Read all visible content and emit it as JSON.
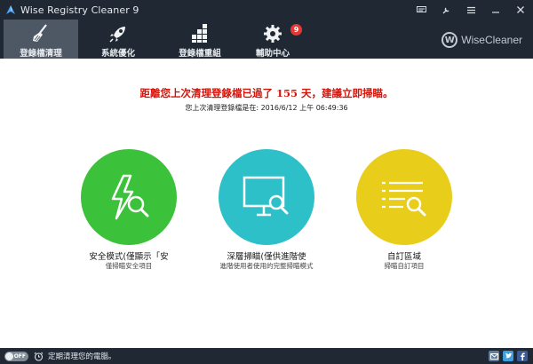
{
  "window": {
    "title": "Wise Registry Cleaner 9"
  },
  "nav": {
    "tabs": [
      {
        "label": "登錄檔清理",
        "icon": "broom-icon",
        "active": true
      },
      {
        "label": "系統優化",
        "icon": "rocket-icon",
        "active": false
      },
      {
        "label": "登錄檔重組",
        "icon": "defrag-icon",
        "active": false
      },
      {
        "label": "輔助中心",
        "icon": "gear-icon",
        "active": false
      }
    ],
    "badge_count": "9",
    "brand": {
      "logo_letter": "W",
      "name": "WiseCleaner"
    }
  },
  "notice": {
    "warning": "距離您上次清理登錄檔已過了 155 天，建議立即掃瞄。",
    "last_clean": "您上次清理登錄檔是在: 2016/6/12 上午 06:49:36"
  },
  "modes": [
    {
      "title": "安全模式(僅顯示「安",
      "desc": "僅掃瞄安全項目",
      "color": "#3cc13b",
      "icon": "lightning-magnifier-icon"
    },
    {
      "title": "深層掃瞄(僅供進階使",
      "desc": "進階使用者使用的完整掃瞄模式",
      "color": "#2ec0c8",
      "icon": "monitor-magnifier-icon"
    },
    {
      "title": "自訂區域",
      "desc": "掃瞄自訂項目",
      "color": "#e8cd1a",
      "icon": "list-magnifier-icon"
    }
  ],
  "status": {
    "toggle_state": "OFF",
    "schedule_text": "定期清理您的電腦。"
  },
  "colors": {
    "chrome": "#1f2833",
    "active_tab": "#4d5864",
    "warning": "#d3140b",
    "badge": "#e53935"
  }
}
